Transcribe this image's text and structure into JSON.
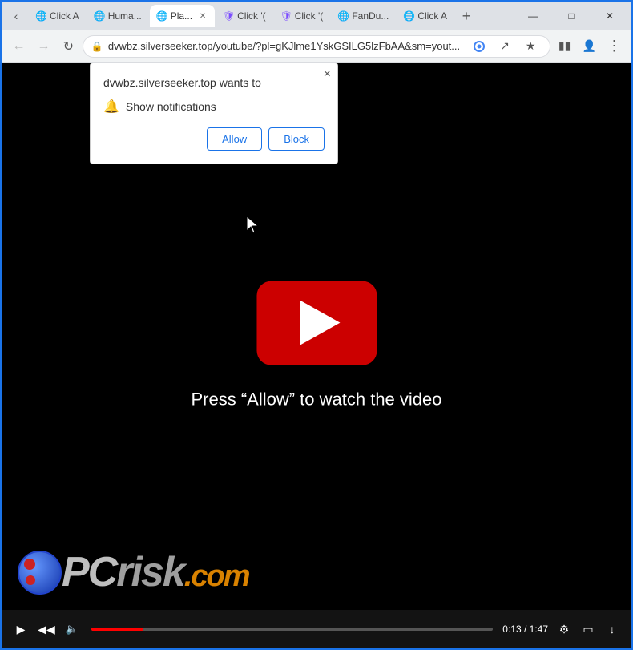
{
  "browser": {
    "tabs": [
      {
        "id": "tab1",
        "label": "Click A",
        "active": false,
        "favicon": "🌐"
      },
      {
        "id": "tab2",
        "label": "Huma...",
        "active": false,
        "favicon": "🌐"
      },
      {
        "id": "tab3",
        "label": "Pla...",
        "active": true,
        "favicon": "🌐"
      },
      {
        "id": "tab4",
        "label": "Click '(",
        "active": false,
        "favicon": "🛡"
      },
      {
        "id": "tab5",
        "label": "Click '(",
        "active": false,
        "favicon": "🛡"
      },
      {
        "id": "tab6",
        "label": "FanDu...",
        "active": false,
        "favicon": "🌐"
      },
      {
        "id": "tab7",
        "label": "Click A",
        "active": false,
        "favicon": "🌐"
      }
    ],
    "address": "dvwbz.silverseeker.top/youtube/?pl=gKJlme1YskGSILG5lzFbAA&sm=yout...",
    "window_controls": {
      "minimize": "—",
      "maximize": "□",
      "close": "✕"
    }
  },
  "popup": {
    "title": "dvwbz.silverseeker.top wants to",
    "close_label": "×",
    "permission_icon": "🔔",
    "permission_text": "Show notifications",
    "allow_label": "Allow",
    "block_label": "Block"
  },
  "video": {
    "prompt": "Press “Allow” to watch the video",
    "time_current": "0:13",
    "time_total": "1:47"
  },
  "watermark": {
    "text": "risk.com",
    "prefix": "PC"
  }
}
